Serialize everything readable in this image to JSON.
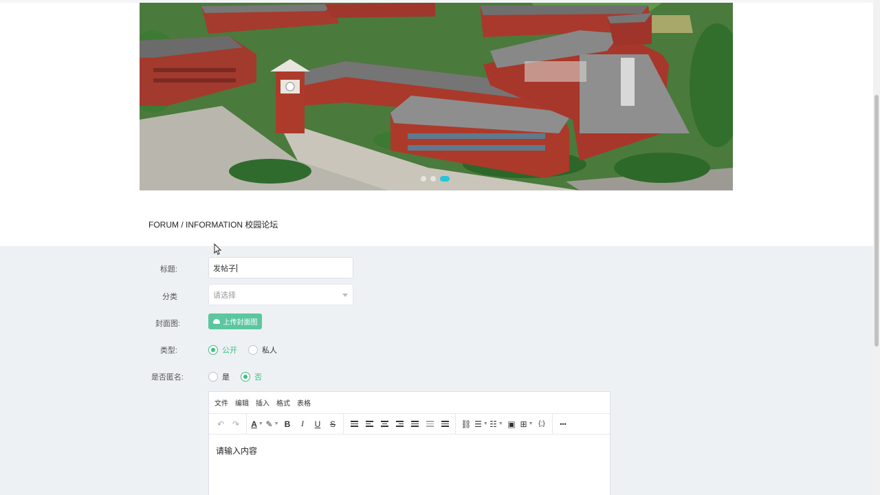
{
  "banner": {
    "image": "aerial-campus-photo",
    "dots": 3,
    "active_dot": 2
  },
  "section": {
    "title": "FORUM / INFORMATION 校园论坛"
  },
  "form": {
    "title_label": "标题:",
    "title_value": "发帖子",
    "category_label": "分类",
    "category_placeholder": "请选择",
    "cover_label": "封面图:",
    "upload_label": "上传封面图",
    "type_label": "类型:",
    "type_options": [
      "公开",
      "私人"
    ],
    "type_selected": "公开",
    "anon_label": "是否匿名:",
    "anon_options": [
      "是",
      "否"
    ],
    "anon_selected": "否"
  },
  "editor": {
    "menu": [
      "文件",
      "编辑",
      "插入",
      "格式",
      "表格"
    ],
    "toolbar_icons": [
      "undo-icon",
      "redo-icon",
      "text-color-icon",
      "highlight-icon",
      "bold-icon",
      "italic-icon",
      "underline-icon",
      "strikethrough-icon",
      "line-height-icon",
      "align-left-icon",
      "align-center-icon",
      "align-right-icon",
      "align-justify-icon",
      "outdent-icon",
      "indent-icon",
      "link-icon",
      "bullet-list-icon",
      "numbered-list-icon",
      "image-icon",
      "table-icon",
      "code-icon",
      "more-icon"
    ],
    "placeholder": "请输入内容",
    "bold": "B",
    "italic": "I",
    "underline": "U",
    "strike": "S",
    "text_color": "A",
    "code": "{;}",
    "more": "•••"
  },
  "colors": {
    "accent": "#3cbf7e",
    "upload_button": "#5cc6a0",
    "page_bg": "#eef1f4"
  }
}
